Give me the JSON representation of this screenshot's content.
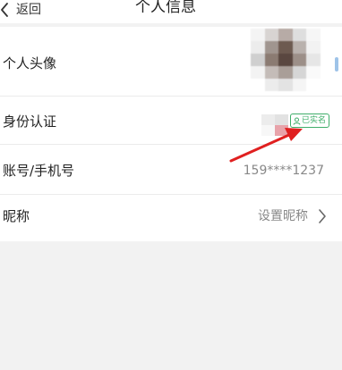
{
  "header": {
    "back_label": "返回",
    "title": "个人信息"
  },
  "rows": {
    "avatar": {
      "label": "个人头像"
    },
    "identity": {
      "label": "身份认证",
      "badge": "已实名"
    },
    "account": {
      "label": "账号/手机号",
      "value": "159****1237"
    },
    "nickname": {
      "label": "昵称",
      "value": "设置昵称"
    }
  },
  "icons": {
    "back": "chevron-left-icon",
    "badge": "person-icon",
    "nickname_arrow": "chevron-right-icon"
  },
  "colors": {
    "badge": "#3fae6a",
    "annotation_arrow": "#e02020",
    "page_background": "#f2f2f2"
  }
}
